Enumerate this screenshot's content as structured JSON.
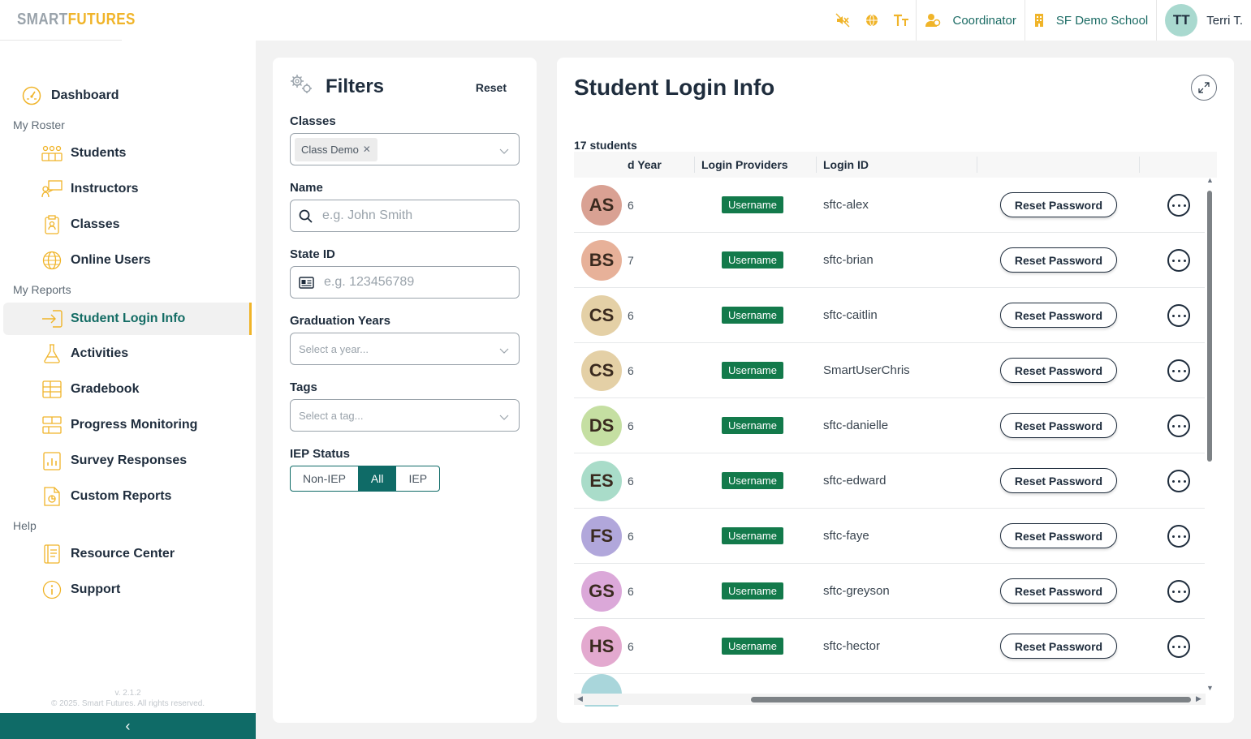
{
  "header": {
    "logo_smart": "SMART",
    "logo_futures": "FUTURES",
    "role": "Coordinator",
    "school": "SF Demo School",
    "user_initials": "TT",
    "user_name": "Terri T.",
    "icons": [
      "mute-icon",
      "globe-icon",
      "text-size-icon",
      "user-role-icon",
      "school-icon"
    ]
  },
  "sidebar": {
    "dashboard": "Dashboard",
    "roster_label": "My Roster",
    "roster_items": [
      {
        "label": "Students",
        "icon": "students-icon"
      },
      {
        "label": "Instructors",
        "icon": "instructors-icon"
      },
      {
        "label": "Classes",
        "icon": "classes-icon"
      },
      {
        "label": "Online Users",
        "icon": "globe-icon"
      }
    ],
    "reports_label": "My Reports",
    "report_items": [
      {
        "label": "Student Login Info",
        "icon": "login-icon",
        "active": true
      },
      {
        "label": "Activities",
        "icon": "flask-icon"
      },
      {
        "label": "Gradebook",
        "icon": "gradebook-icon"
      },
      {
        "label": "Progress Monitoring",
        "icon": "progress-icon"
      },
      {
        "label": "Survey Responses",
        "icon": "survey-icon"
      },
      {
        "label": "Custom Reports",
        "icon": "custom-report-icon"
      }
    ],
    "help_label": "Help",
    "help_items": [
      {
        "label": "Resource Center",
        "icon": "book-icon"
      },
      {
        "label": "Support",
        "icon": "info-icon"
      }
    ],
    "version": "v. 2.1.2",
    "copyright": "© 2025. Smart Futures. All rights reserved.",
    "collapse_glyph": "‹"
  },
  "filters": {
    "title": "Filters",
    "reset": "Reset",
    "classes_label": "Classes",
    "classes_chip": "Class Demo",
    "name_label": "Name",
    "name_placeholder": "e.g. John Smith",
    "state_id_label": "State ID",
    "state_id_placeholder": "e.g. 123456789",
    "grad_label": "Graduation Years",
    "grad_placeholder": "Select a year...",
    "tags_label": "Tags",
    "tags_placeholder": "Select a tag...",
    "iep_label": "IEP Status",
    "iep_options": [
      "Non-IEP",
      "All",
      "IEP"
    ],
    "iep_selected": "All"
  },
  "main": {
    "title": "Student Login Info",
    "count": "17 students",
    "columns": [
      "d Year",
      "Login Providers",
      "Login ID"
    ],
    "reset_label": "Reset Password",
    "rows": [
      {
        "initials": "AS",
        "color": "#d9a193",
        "year": "6",
        "provider": "Username",
        "login": "sftc-alex"
      },
      {
        "initials": "BS",
        "color": "#e7b199",
        "year": "7",
        "provider": "Username",
        "login": "sftc-brian"
      },
      {
        "initials": "CS",
        "color": "#e4d0a6",
        "year": "6",
        "provider": "Username",
        "login": "sftc-caitlin"
      },
      {
        "initials": "CS",
        "color": "#e4d0a6",
        "year": "6",
        "provider": "Username",
        "login": "SmartUserChris"
      },
      {
        "initials": "DS",
        "color": "#c5dfa2",
        "year": "6",
        "provider": "Username",
        "login": "sftc-danielle"
      },
      {
        "initials": "ES",
        "color": "#a9dcc9",
        "year": "6",
        "provider": "Username",
        "login": "sftc-edward"
      },
      {
        "initials": "FS",
        "color": "#b1a7db",
        "year": "6",
        "provider": "Username",
        "login": "sftc-faye"
      },
      {
        "initials": "GS",
        "color": "#dba8d9",
        "year": "6",
        "provider": "Username",
        "login": "sftc-greyson"
      },
      {
        "initials": "HS",
        "color": "#e3a9cf",
        "year": "6",
        "provider": "Username",
        "login": "sftc-hector"
      },
      {
        "initials": "",
        "color": "#a9d6db",
        "year": "",
        "provider": "",
        "login": ""
      }
    ]
  },
  "colors": {
    "teal": "#0f6b67",
    "gold": "#f0b429",
    "badge_green": "#137a4b"
  }
}
